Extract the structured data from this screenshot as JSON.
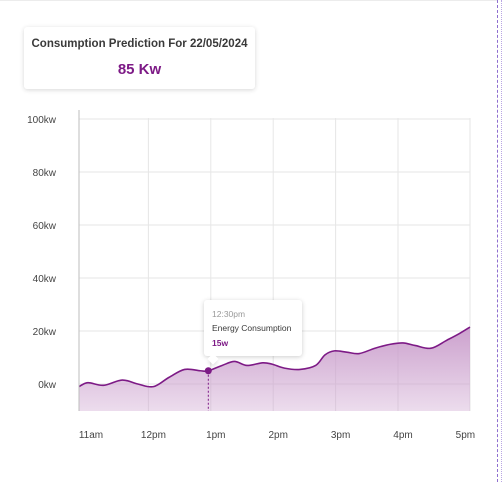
{
  "prediction_card": {
    "title": "Consumption Prediction For 22/05/2024",
    "value": "85 Kw"
  },
  "tooltip": {
    "time": "12:30pm",
    "label": "Energy Consumption",
    "value": "15w"
  },
  "colors": {
    "accent": "#7d1a86",
    "area_fill": "#c99ccb",
    "grid": "#e6e6e6",
    "axis_text": "#444444"
  },
  "chart_data": {
    "type": "area",
    "title": "",
    "xlabel": "",
    "ylabel": "",
    "x_tick_labels": [
      "11am",
      "12pm",
      "1pm",
      "2pm",
      "3pm",
      "4pm",
      "5pm"
    ],
    "y_tick_labels": [
      "0kw",
      "20kw",
      "40kw",
      "60kw",
      "80kw",
      "100kw"
    ],
    "x_range_hours": [
      11,
      17.1
    ],
    "ylim": [
      -10,
      100
    ],
    "grid": true,
    "series": [
      {
        "x": [
          10.8,
          10.95,
          11.2,
          11.5,
          11.75,
          12.0,
          12.25,
          12.5,
          12.75,
          12.88,
          13.1,
          13.3,
          13.5,
          13.75,
          13.9,
          14.1,
          14.35,
          14.6,
          14.75,
          14.9,
          15.1,
          15.3,
          15.55,
          15.8,
          16.0,
          16.2,
          16.45,
          16.7,
          16.9,
          17.1
        ],
        "y": [
          -1,
          0.5,
          -0.5,
          1.5,
          0,
          -1,
          2.5,
          5.5,
          5,
          5,
          7,
          8.5,
          7,
          8,
          7.5,
          6,
          5.5,
          7,
          11,
          12.5,
          12,
          11.5,
          13.5,
          15,
          15.5,
          14.5,
          13.5,
          16.5,
          19,
          21.5
        ]
      }
    ],
    "highlight": {
      "x": 12.88,
      "y": 5
    }
  }
}
